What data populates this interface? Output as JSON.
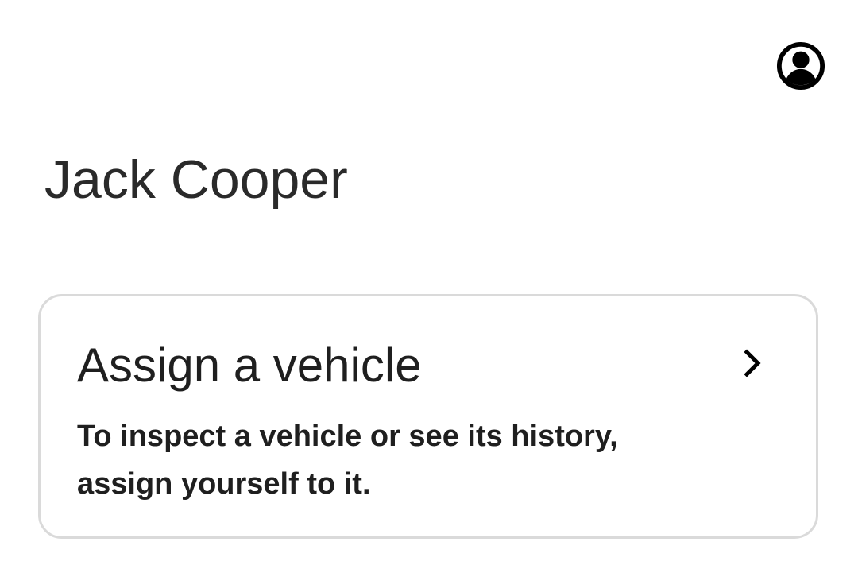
{
  "header": {
    "account_icon": "account-circle-icon"
  },
  "profile": {
    "name": "Jack Cooper"
  },
  "assign_card": {
    "title": "Assign a vehicle",
    "description": "To inspect a vehicle or see its history, assign yourself to it.",
    "chevron_icon": "chevron-right-icon"
  }
}
